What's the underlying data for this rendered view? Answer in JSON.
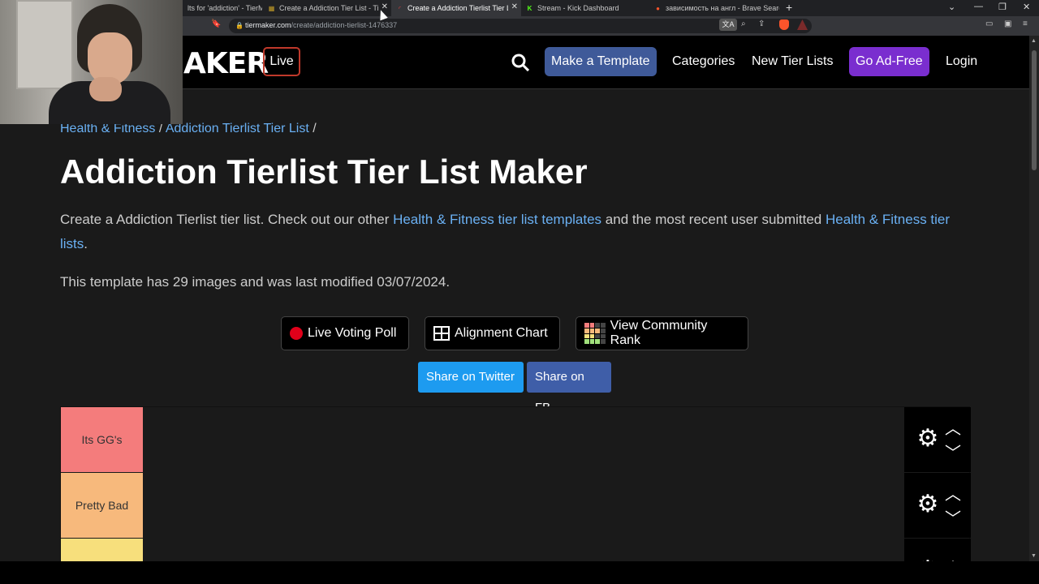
{
  "browser": {
    "tabs": [
      {
        "title": "lts for 'addiction' - TierMa",
        "active": false,
        "fav": "T",
        "favcolor": "#bbbbbb"
      },
      {
        "title": "Create a Addiction Tier List - TierMa",
        "active": false,
        "fav": "T",
        "favcolor": "#c9a227"
      },
      {
        "title": "Create a Addiction Tierlist Tier Lis",
        "active": true,
        "fav": "◜",
        "favcolor": "#e04040"
      },
      {
        "title": "Stream - Kick Dashboard",
        "active": false,
        "fav": "K",
        "favcolor": "#53fc18"
      },
      {
        "title": "зависимость на англ - Brave Search",
        "active": false,
        "fav": "●",
        "favcolor": "#fb542b"
      }
    ],
    "url_host": "tiermaker.com",
    "url_path": "/create/addiction-tierlist-1476337"
  },
  "header": {
    "logo": "AKER",
    "live": "Live",
    "nav": {
      "make_template": "Make a Template",
      "categories": "Categories",
      "new_lists": "New Tier Lists",
      "ad_free": "Go Ad-Free",
      "login": "Login"
    }
  },
  "breadcrumb": {
    "category": "Health & Fitness",
    "sep1": " / ",
    "list": "Addiction Tierlist Tier List",
    "sep2": " /"
  },
  "page": {
    "title": "Addiction Tierlist Tier List Maker",
    "desc_part1": "Create a Addiction Tierlist tier list. Check out our other ",
    "desc_link1": "Health & Fitness tier list templates",
    "desc_part2": " and the most recent user submitted ",
    "desc_link2": "Health & Fitness tier lists",
    "desc_part3": ".",
    "meta": "This template has 29 images and was last modified 03/07/2024."
  },
  "actions": {
    "poll": "Live Voting Poll",
    "alignment": "Alignment Chart",
    "community": "View Community Rank",
    "twitter": "Share on Twitter",
    "fb": "Share on FB"
  },
  "tiers": [
    {
      "label": "Its GG's",
      "color": "#f47c7c"
    },
    {
      "label": "Pretty Bad",
      "color": "#f7b97c"
    },
    {
      "label": "",
      "color": "#f7df7c"
    }
  ]
}
